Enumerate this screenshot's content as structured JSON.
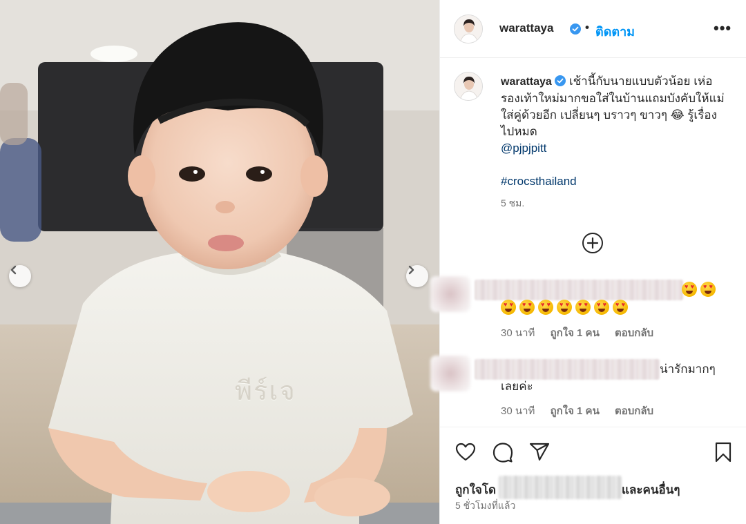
{
  "header": {
    "username": "warattaya",
    "separator": "•",
    "follow_label": "ติดตาม",
    "more_label": "•••"
  },
  "caption": {
    "username": "warattaya",
    "text_part1": "เช้านี้กับนายแบบตัวน้อย เห่อรองเท้าใหม่มากขอใส่ในบ้านแถมบังคับให้แม่ใส่คู่ด้วยอีก เปลี่ยนๆ บราวๆ ขาวๆ 😂 รู้เรื่องไปหมด",
    "mention": "@pjpjpitt",
    "hashtag": "#crocsthailand",
    "time": "5 ชม."
  },
  "comments": [
    {
      "emoji_count_line1": 2,
      "emoji_count_line2": 7,
      "time": "30 นาที",
      "likes": "ถูกใจ 1 คน",
      "reply": "ตอบกลับ"
    },
    {
      "text_line1": "น่ารักมากๆ",
      "text_line2": "เลยค่ะ",
      "time": "30 นาที",
      "likes": "ถูกใจ 1 คน",
      "reply": "ตอบกลับ"
    }
  ],
  "footer": {
    "liked_by_prefix": "ถูกใจโด",
    "liked_by_suffix": "และคนอื่นๆ",
    "post_time": "5 ชั่วโมงที่แล้ว"
  },
  "photo": {
    "shirt_text": "พีร์เจ"
  },
  "colors": {
    "accent": "#0095f6",
    "link": "#00376b",
    "secondary_text": "#737373"
  },
  "icons": [
    "chevron-left-icon",
    "chevron-right-icon",
    "verified-icon",
    "more-icon",
    "plus-circle-icon",
    "heart-icon",
    "comment-icon",
    "share-icon",
    "bookmark-icon"
  ]
}
